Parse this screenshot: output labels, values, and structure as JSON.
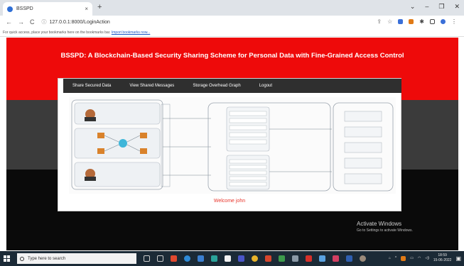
{
  "browser": {
    "tab_title": "BSSPD",
    "tab_close": "×",
    "new_tab": "+",
    "minimize": "–",
    "maximize": "❐",
    "close": "✕",
    "back": "←",
    "forward": "→",
    "reload": "C",
    "url": "127.0.0.1:8000/LoginAction",
    "bookmark_text": "For quick access, place your bookmarks here on the bookmarks bar.",
    "bookmark_link": "Import bookmarks now..."
  },
  "page": {
    "title": "BSSPD: A Blockchain-Based Security Sharing Scheme for Personal Data with Fine-Grained Access Control",
    "menu": [
      {
        "label": "Share Secured Data"
      },
      {
        "label": "View Shared Messages"
      },
      {
        "label": "Storage Overhead Graph"
      },
      {
        "label": "Logout"
      }
    ],
    "welcome": "Welcome john"
  },
  "windows": {
    "activate_title": "Activate Windows",
    "activate_sub": "Go to Settings to activate Windows.",
    "search_placeholder": "Type here to search",
    "time": "18:59",
    "date": "15-06-2022"
  },
  "colors": {
    "header_red": "#ee0a0a",
    "menu_bg": "#2f2f2f",
    "welcome_red": "#e8342a"
  }
}
